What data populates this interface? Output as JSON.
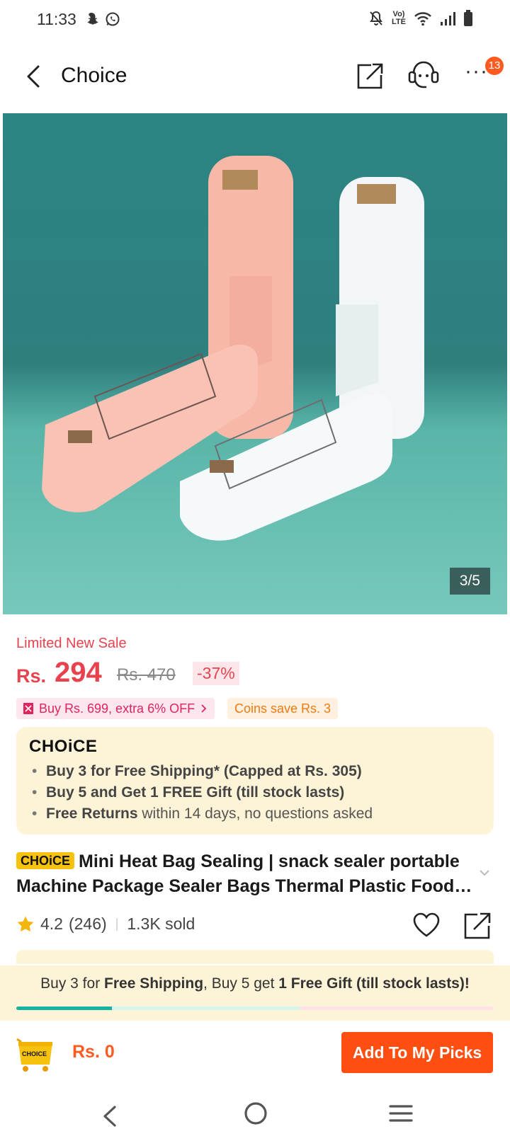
{
  "status_bar": {
    "time": "11:33",
    "left_icons": [
      "snapchat-icon",
      "whatsapp-icon"
    ],
    "right_icons": [
      "mute-icon",
      "volte-icon",
      "wifi-icon",
      "signal-icon",
      "battery-icon"
    ],
    "volte_label": "Vo) LTE"
  },
  "header": {
    "title": "Choice",
    "notification_count": "13",
    "more_label": "···"
  },
  "gallery": {
    "counter": "3/5"
  },
  "price": {
    "limited_label": "Limited New Sale",
    "currency": "Rs.",
    "current": "294",
    "original": "Rs. 470",
    "discount": "-37%"
  },
  "promo": {
    "buy_more": "Buy Rs. 699, extra 6% OFF",
    "coins": "Coins save Rs. 3"
  },
  "choice_box": {
    "logo": "CHOiCE",
    "items": [
      {
        "bold": "Buy 3 for  Free Shipping* (Capped at Rs. 305)",
        "rest": ""
      },
      {
        "bold": "Buy 5 and Get 1 FREE Gift (till stock lasts)",
        "rest": ""
      },
      {
        "bold": "Free Returns",
        "rest": " within 14 days, no questions asked"
      }
    ]
  },
  "product": {
    "tag": "CHOiCE",
    "title": "Mini Heat Bag Sealing | snack sealer portable Machine Package Sealer Bags Thermal Plastic Food Bag Closure"
  },
  "rating": {
    "score": "4.2",
    "reviews": "(246)",
    "sold": "1.3K sold"
  },
  "banner": {
    "part1": "Buy 3 for ",
    "bold1": "Free Shipping",
    "part2": ", Buy 5 get ",
    "bold2": "1 Free Gift (till stock lasts)!",
    "progress_fraction": 0.2
  },
  "bottom": {
    "cart_label": "CHOICE",
    "total": "Rs. 0",
    "add_button": "Add To My Picks"
  },
  "colors": {
    "accent": "#ff4e12",
    "price_red": "#e7424e",
    "choice_yellow": "#f6c20e",
    "progress_teal": "#16b3a2"
  }
}
